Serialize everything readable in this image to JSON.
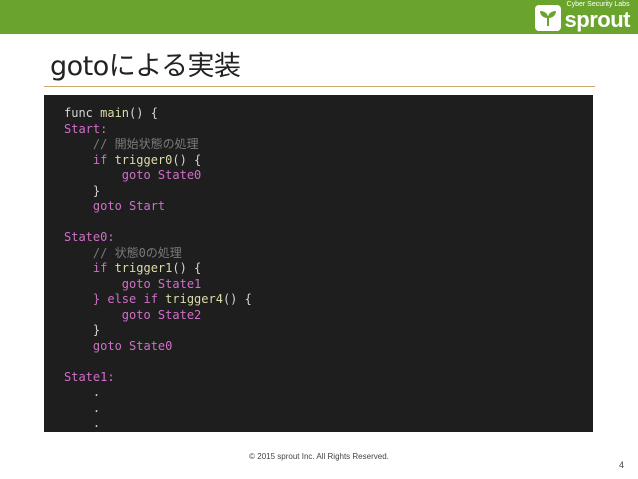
{
  "header": {
    "logo_tagline": "Cyber Security Labs",
    "logo_name": "sprout",
    "brand_color": "#6aa42c"
  },
  "slide": {
    "title": "gotoによる実装",
    "code_lines": [
      [
        {
          "t": "func ",
          "k": "plain"
        },
        {
          "t": "main",
          "k": "call"
        },
        {
          "t": "() {",
          "k": "plain"
        }
      ],
      [
        {
          "t": "Start:",
          "k": "label"
        }
      ],
      [
        {
          "t": "    // 開始状態の処理",
          "k": "comment"
        }
      ],
      [
        {
          "t": "    if ",
          "k": "kw"
        },
        {
          "t": "trigger0",
          "k": "call"
        },
        {
          "t": "() {",
          "k": "plain"
        }
      ],
      [
        {
          "t": "        goto ",
          "k": "kw"
        },
        {
          "t": "State0",
          "k": "label"
        }
      ],
      [
        {
          "t": "    }",
          "k": "plain"
        }
      ],
      [
        {
          "t": "    goto ",
          "k": "kw"
        },
        {
          "t": "Start",
          "k": "label"
        }
      ],
      [
        {
          "t": "",
          "k": "plain"
        }
      ],
      [
        {
          "t": "State0:",
          "k": "label"
        }
      ],
      [
        {
          "t": "    // 状態0の処理",
          "k": "comment"
        }
      ],
      [
        {
          "t": "    if ",
          "k": "kw"
        },
        {
          "t": "trigger1",
          "k": "call"
        },
        {
          "t": "() {",
          "k": "plain"
        }
      ],
      [
        {
          "t": "        goto ",
          "k": "kw"
        },
        {
          "t": "State1",
          "k": "label"
        }
      ],
      [
        {
          "t": "    } else if ",
          "k": "kw"
        },
        {
          "t": "trigger4",
          "k": "call"
        },
        {
          "t": "() {",
          "k": "plain"
        }
      ],
      [
        {
          "t": "        goto ",
          "k": "kw"
        },
        {
          "t": "State2",
          "k": "label"
        }
      ],
      [
        {
          "t": "    }",
          "k": "plain"
        }
      ],
      [
        {
          "t": "    goto ",
          "k": "kw"
        },
        {
          "t": "State0",
          "k": "label"
        }
      ],
      [
        {
          "t": "",
          "k": "plain"
        }
      ],
      [
        {
          "t": "State1:",
          "k": "label"
        }
      ],
      [
        {
          "t": "    .",
          "k": "plain"
        }
      ],
      [
        {
          "t": "    .",
          "k": "plain"
        }
      ],
      [
        {
          "t": "    .",
          "k": "plain"
        }
      ]
    ]
  },
  "footer": {
    "copyright": "© 2015 sprout Inc. All Rights Reserved.",
    "page_number": "4"
  }
}
